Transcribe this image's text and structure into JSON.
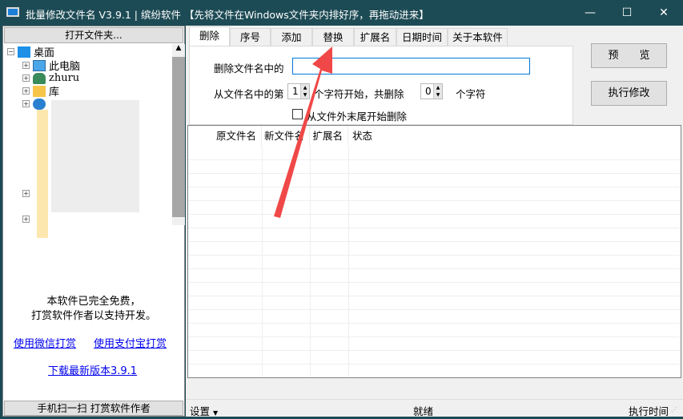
{
  "window": {
    "title": "批量修改文件名 V3.9.1 | 缤纷软件   【先将文件在Windows文件夹内排好序，再拖动进来】",
    "minimize": "—",
    "maximize": "☐",
    "close": "✕"
  },
  "left": {
    "open_folder": "打开文件夹...",
    "tree": [
      {
        "label": "桌面",
        "icon": "desktop-icon"
      },
      {
        "label": "此电脑",
        "icon": "computer-icon"
      },
      {
        "label": "zhuru",
        "icon": "user-icon"
      },
      {
        "label": "库",
        "icon": "library-icon"
      }
    ],
    "free_line1": "本软件已完全免费，",
    "free_line2": "打赏软件作者以支持开发。",
    "wechat_link": "使用微信打赏",
    "alipay_link": "使用支付宝打赏",
    "download_link": "下载最新版本3.9.1",
    "scan_button": "手机扫一扫 打赏软件作者"
  },
  "tabs": [
    {
      "label": "删除"
    },
    {
      "label": "序号"
    },
    {
      "label": "添加"
    },
    {
      "label": "替换"
    },
    {
      "label": "扩展名"
    },
    {
      "label": "日期时间"
    },
    {
      "label": "关于本软件"
    }
  ],
  "delete_panel": {
    "name_label": "删除文件名中的",
    "name_value": "",
    "from_label": "从文件名中的第",
    "start_value": "1",
    "middle_label": "个字符开始，共删除",
    "count_value": "0",
    "end_label": "个字符",
    "checkbox_label": "从文件外末尾开始删除",
    "checkbox_checked": false
  },
  "buttons": {
    "preview": "预　　览",
    "execute": "执行修改"
  },
  "list": {
    "columns": [
      "原文件名",
      "新文件名",
      "扩展名",
      "状态"
    ]
  },
  "status": {
    "settings": "设置",
    "ready": "就绪",
    "exec_time": "执行时间"
  },
  "colors": {
    "titlebar": "#1d4b55",
    "annotation_arrow": "#f04848",
    "link": "#0000ee",
    "input_focus": "#0078d7"
  }
}
